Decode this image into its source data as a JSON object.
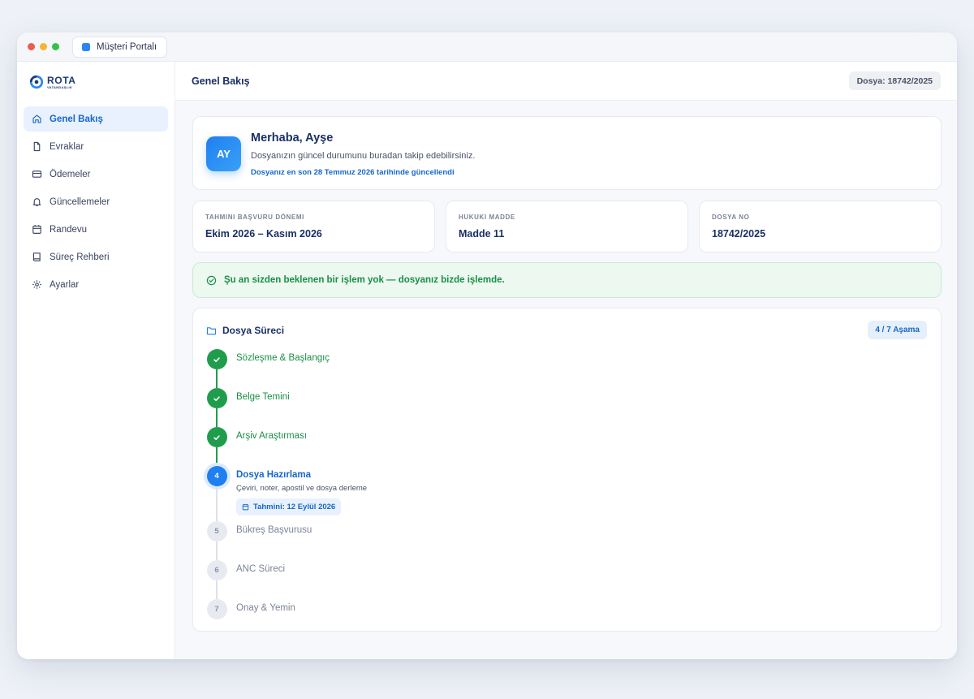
{
  "window": {
    "tab_title": "Müşteri Portalı"
  },
  "brand": {
    "name": "ROTA",
    "subtitle": "VATANDAŞLIK"
  },
  "sidebar": {
    "items": [
      {
        "label": "Genel Bakış",
        "icon": "home-icon",
        "active": true
      },
      {
        "label": "Evraklar",
        "icon": "document-icon"
      },
      {
        "label": "Ödemeler",
        "icon": "credit-card-icon"
      },
      {
        "label": "Güncellemeler",
        "icon": "bell-icon"
      },
      {
        "label": "Randevu",
        "icon": "calendar-icon"
      },
      {
        "label": "Süreç Rehberi",
        "icon": "book-icon"
      },
      {
        "label": "Ayarlar",
        "icon": "gear-icon"
      }
    ]
  },
  "header": {
    "title": "Genel Bakış",
    "file_badge": "Dosya: 18742/2025"
  },
  "welcome": {
    "initials": "AY",
    "greeting": "Merhaba, Ayşe",
    "description": "Dosyanızın güncel durumunu buradan takip edebilirsiniz.",
    "updated": "Dosyanız en son 28 Temmuz 2026 tarihinde güncellendi"
  },
  "stats": [
    {
      "label": "TAHMINI BAŞVURU DÖNEMI",
      "value": "Ekim 2026 – Kasım 2026"
    },
    {
      "label": "HUKUKI MADDE",
      "value": "Madde 11"
    },
    {
      "label": "DOSYA NO",
      "value": "18742/2025"
    }
  ],
  "alert": {
    "text": "Şu an sizden beklenen bir işlem yok — dosyanız bizde işlemde."
  },
  "process": {
    "title": "Dosya Süreci",
    "stage_badge": "4 / 7 Aşama",
    "steps": [
      {
        "number": "1",
        "name": "Sözleşme & Başlangıç",
        "status": "done"
      },
      {
        "number": "2",
        "name": "Belge Temini",
        "status": "done"
      },
      {
        "number": "3",
        "name": "Arşiv Araştırması",
        "status": "done"
      },
      {
        "number": "4",
        "name": "Dosya Hazırlama",
        "status": "current",
        "description": "Çeviri, noter, apostil ve dosya derleme",
        "estimate": "Tahmini: 12 Eylül 2026"
      },
      {
        "number": "5",
        "name": "Bükreş Başvurusu",
        "status": "pending"
      },
      {
        "number": "6",
        "name": "ANC Süreci",
        "status": "pending"
      },
      {
        "number": "7",
        "name": "Onay & Yemin",
        "status": "pending"
      }
    ]
  },
  "colors": {
    "accent": "#1f7ff0",
    "success": "#1f9d4c",
    "navy": "#1a2f66"
  }
}
